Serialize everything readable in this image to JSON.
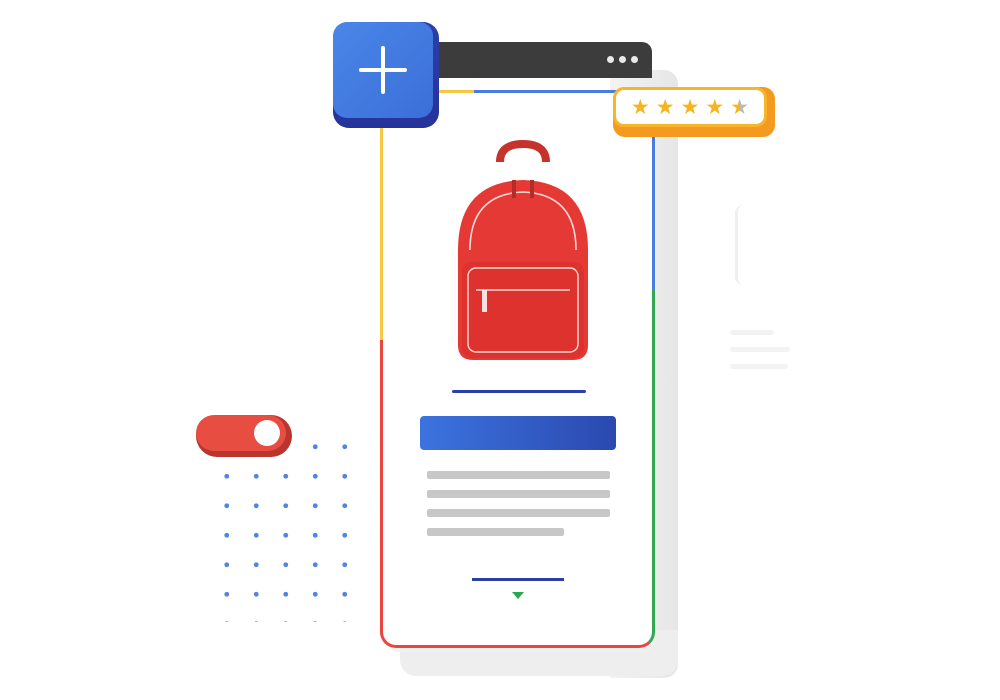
{
  "illustration": {
    "add_button": {
      "icon": "plus-icon",
      "color": "#4A86E8"
    },
    "rating": {
      "value": 4.5,
      "max": 5,
      "star_color": "#F6B51C",
      "border_color": "#F7B52B"
    },
    "product": {
      "icon": "backpack-icon",
      "color": "#E53935"
    },
    "toggle": {
      "state": "on",
      "color": "#E84D41"
    },
    "title_bar_color": "#3C73DE",
    "text_lines": 4,
    "accent_colors": {
      "blue": "#4A7BE0",
      "red": "#E8473F",
      "yellow": "#F7C843",
      "green": "#33A853"
    }
  }
}
